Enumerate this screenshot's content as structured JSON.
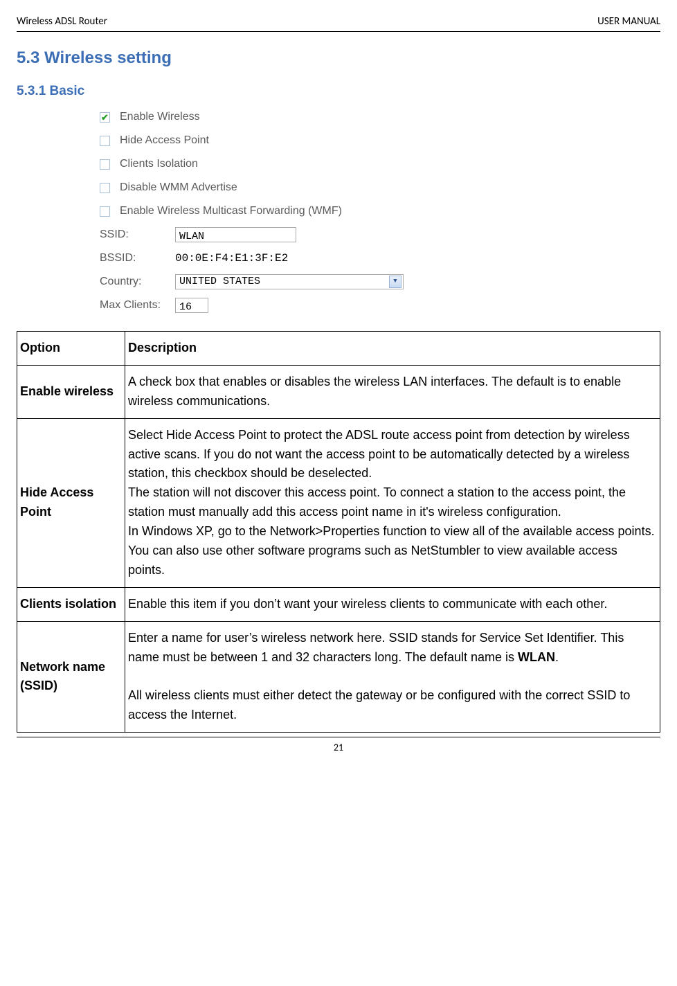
{
  "header": {
    "left": "Wireless ADSL Router",
    "right": "USER MANUAL"
  },
  "titles": {
    "section": "5.3 Wireless setting",
    "subsection": "5.3.1 Basic"
  },
  "form": {
    "checkboxes": [
      {
        "label": "Enable Wireless",
        "checked": true
      },
      {
        "label": "Hide Access Point",
        "checked": false
      },
      {
        "label": "Clients Isolation",
        "checked": false
      },
      {
        "label": "Disable WMM Advertise",
        "checked": false
      },
      {
        "label": "Enable Wireless Multicast Forwarding (WMF)",
        "checked": false
      }
    ],
    "ssid_label": "SSID:",
    "ssid_value": "WLAN",
    "bssid_label": "BSSID:",
    "bssid_value": "00:0E:F4:E1:3F:E2",
    "country_label": "Country:",
    "country_value": "UNITED STATES",
    "maxclients_label": "Max Clients:",
    "maxclients_value": "16"
  },
  "table": {
    "header_option": "Option",
    "header_description": "Description",
    "rows": [
      {
        "option": "Enable wireless",
        "description": "A check box that enables or disables the wireless LAN interfaces. The default is to enable wireless communications."
      },
      {
        "option": "Hide Access Point",
        "description": "Select Hide Access Point to protect the ADSL route access point from detection by wireless active scans. If you do not want the access point to be automatically detected by a wireless station, this checkbox should be deselected.\nThe station will not discover this access point. To connect a station to the access point, the station must manually add this access point name in it's wireless configuration.\nIn Windows XP, go to the Network>Properties function to view all of the available access points. You can also use other software programs such as NetStumbler to view available access points."
      },
      {
        "option": "Clients isolation",
        "description": "Enable this item if you don’t want your wireless clients to communicate with each other."
      },
      {
        "option": "Network name (SSID)",
        "description_html": "Enter a name for user’s wireless network here. SSID stands for Service Set Identifier. This name must be between 1 and 32 characters long. The default name is <b>WLAN</b>.<br><br>All wireless clients must either detect the gateway or be configured with the correct SSID to access the Internet."
      }
    ]
  },
  "page_number": "21"
}
